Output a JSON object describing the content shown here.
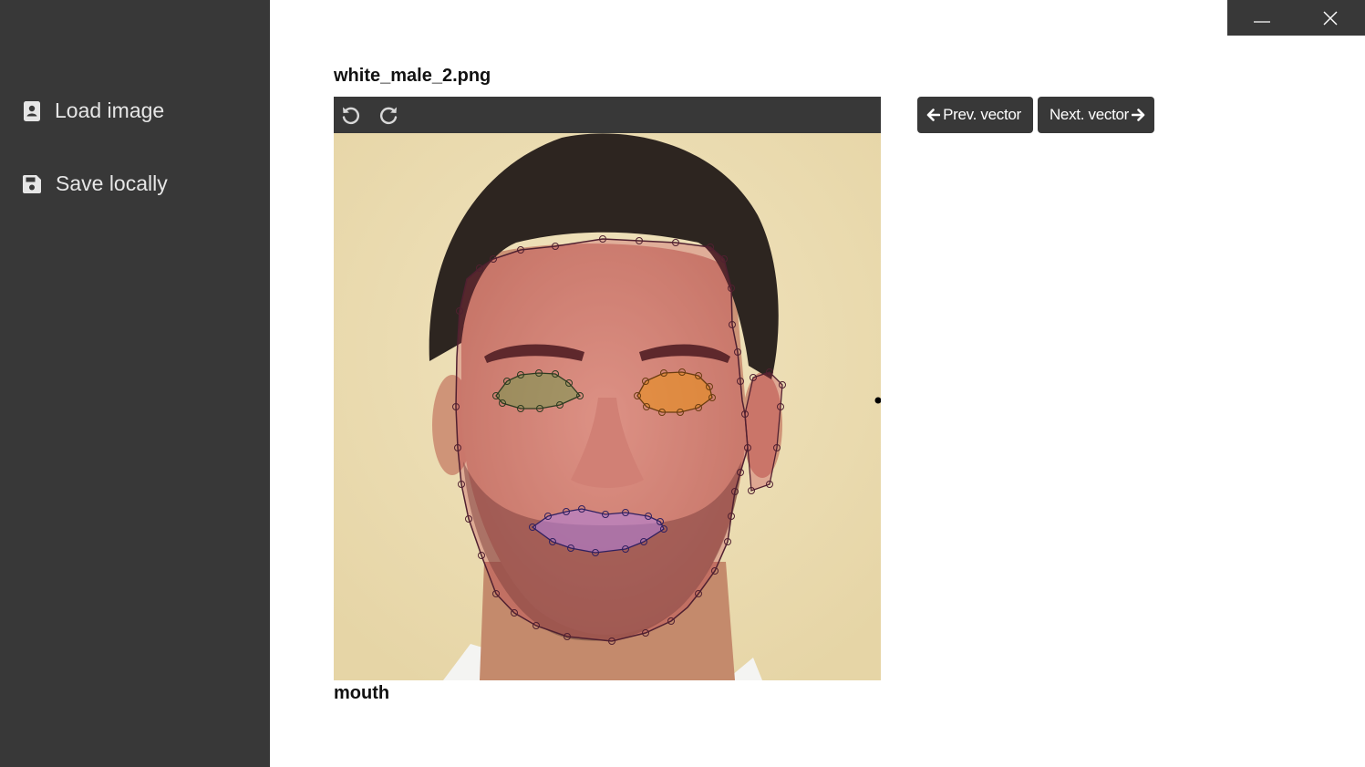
{
  "sidebar": {
    "items": [
      {
        "label": "Load image",
        "icon": "contact-card-icon"
      },
      {
        "label": "Save locally",
        "icon": "floppy-disk-icon"
      }
    ]
  },
  "window_controls": {
    "minimize_icon": "minimize-icon",
    "close_icon": "close-icon"
  },
  "image": {
    "filename": "white_male_2.png"
  },
  "toolbar": {
    "undo_icon": "undo-icon",
    "redo_icon": "redo-icon"
  },
  "navigation": {
    "prev_label": "Prev. vector",
    "next_label": "Next. vector"
  },
  "current_vector": "mouth",
  "colors": {
    "sidebar_bg": "#383838",
    "button_bg": "#383838",
    "face_region": "#c0304a",
    "left_eye_region": "#6b9a4a",
    "right_eye_region": "#e8901e",
    "mouth_region": "#b080d8"
  }
}
